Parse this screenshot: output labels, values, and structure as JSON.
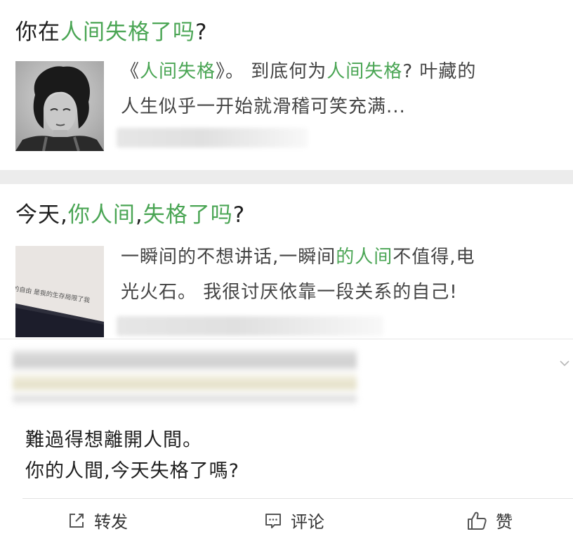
{
  "articles": [
    {
      "title_prefix": "你在",
      "title_highlight": "人间失格了吗",
      "title_suffix": "?",
      "summary_line1_a": "《",
      "summary_line1_b": "人间失格",
      "summary_line1_c": "》。 到底何为",
      "summary_line1_d": "人间失格",
      "summary_line1_e": "?  叶藏的",
      "summary_line2": "人生似乎一开始就滑稽可笑充满...",
      "thumbnail": "portrait-photo"
    },
    {
      "title_prefix": "今天,",
      "title_highlight1": "你人间",
      "title_mid": ",",
      "title_highlight2": "失格了吗",
      "title_suffix": "?",
      "summary_line1_a": "一瞬间的不想讲话,一瞬间",
      "summary_line1_b": "的人间",
      "summary_line1_c": "不值得,电",
      "summary_line2": "光火石。 我很讨厌依靠一段关系的自己!",
      "thumbnail": "book-page-photo",
      "thumbnail_text_1": "的自由 是我的生存局限了我",
      "thumbnail_text_2": "自由"
    }
  ],
  "comment": {
    "line1": "難過得想離開人間。",
    "line2": "你的人間,今天失格了嗎?",
    "chevron_icon": "chevron-down-icon"
  },
  "actions": {
    "forward": {
      "label": "转发",
      "icon": "share-icon"
    },
    "comment": {
      "label": "评论",
      "icon": "comment-icon"
    },
    "like": {
      "label": "赞",
      "icon": "thumbs-up-icon"
    }
  },
  "colors": {
    "highlight": "#4aa554",
    "separator": "#ececec"
  }
}
